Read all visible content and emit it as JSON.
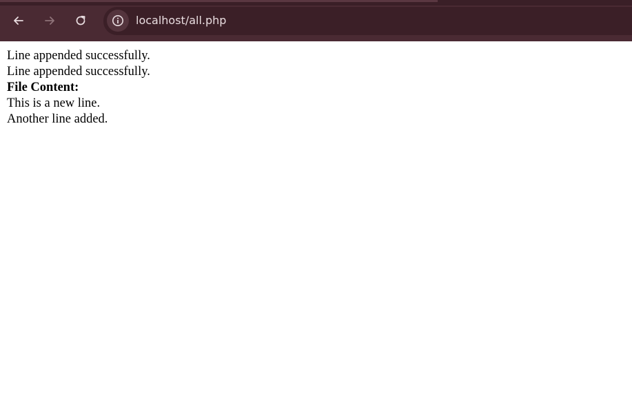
{
  "browser": {
    "url": "localhost/all.php",
    "icons": {
      "back": "back-arrow-icon",
      "forward": "forward-arrow-icon",
      "reload": "reload-icon",
      "site_info": "info-icon"
    },
    "colors": {
      "toolbar": "#4a2a33",
      "omnibox": "#3b1f27"
    }
  },
  "page": {
    "messages": [
      "Line appended successfully.",
      "Line appended successfully."
    ],
    "file_content_label": "File Content:",
    "file_lines": [
      "This is a new line.",
      "Another line added."
    ]
  }
}
